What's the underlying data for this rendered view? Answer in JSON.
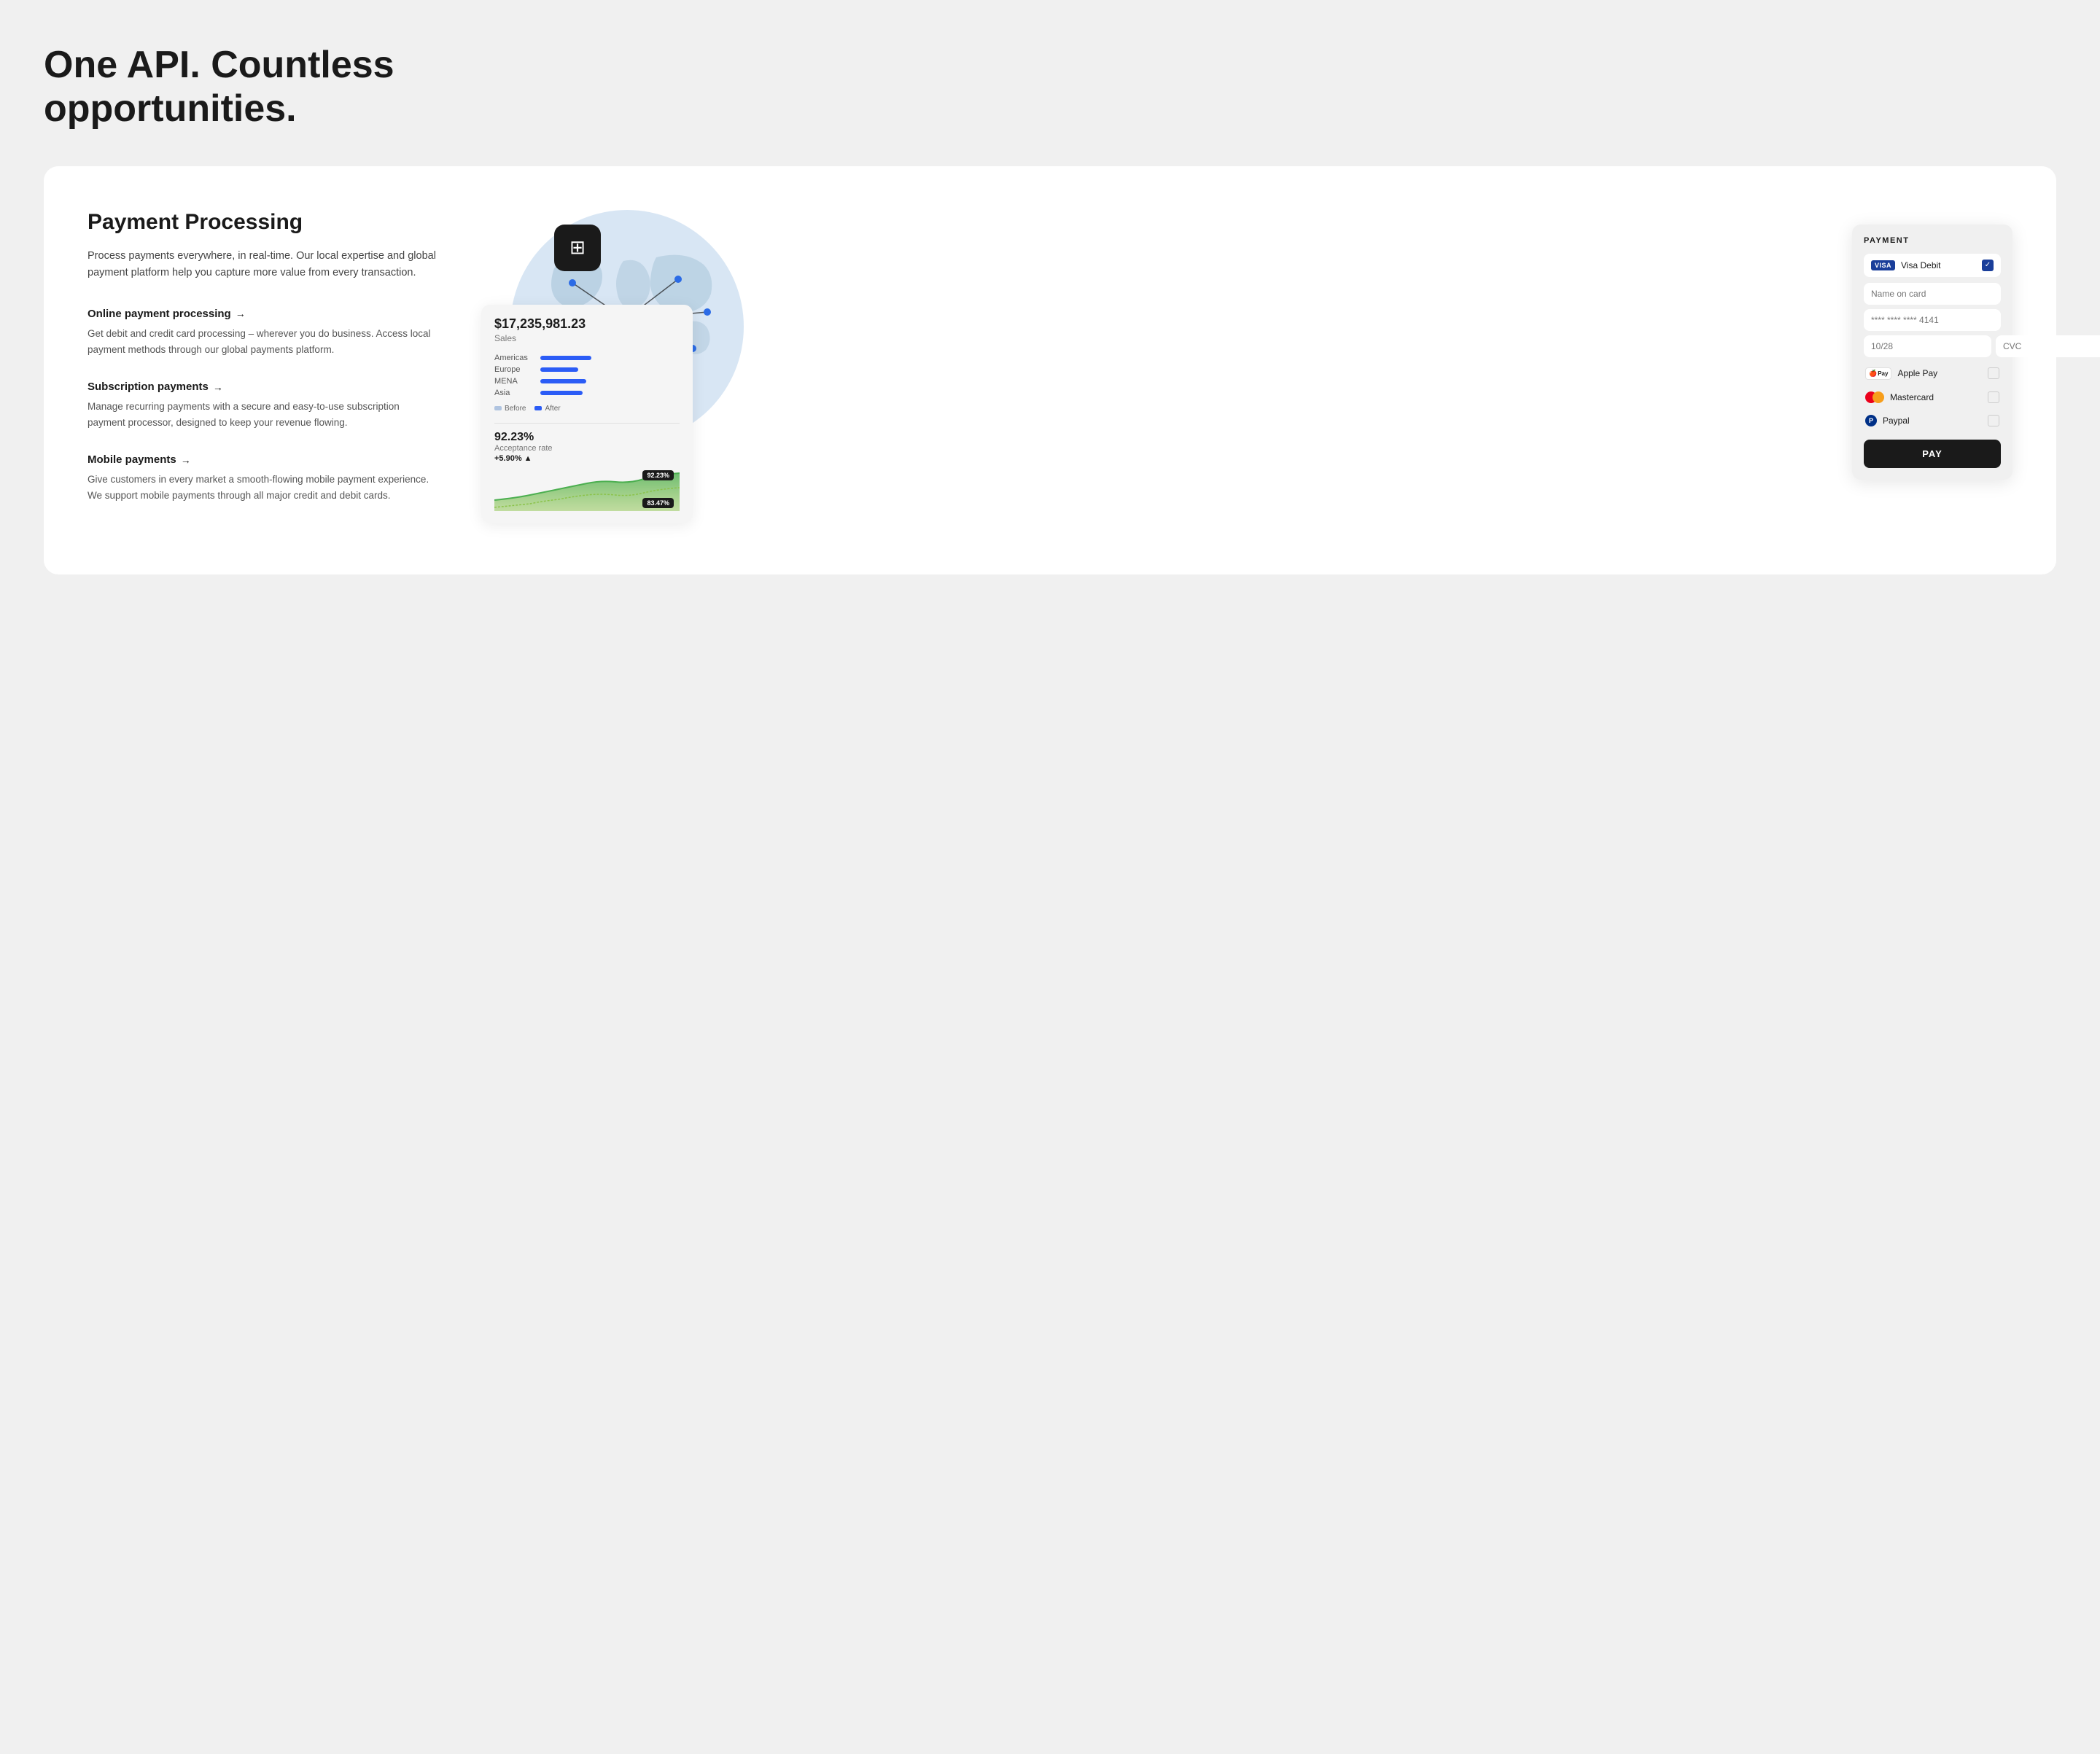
{
  "page": {
    "title_line1": "One API. Countless",
    "title_line2": "opportunities."
  },
  "card": {
    "section_title": "Payment Processing",
    "section_desc": "Process payments everywhere, in real-time. Our local expertise and global payment platform help you capture more value from every transaction.",
    "features": [
      {
        "title": "Online payment processing",
        "arrow": "→",
        "desc": "Get debit and credit card processing – wherever you do business. Access local payment methods through our global payments platform."
      },
      {
        "title": "Subscription payments",
        "arrow": "→",
        "desc": "Manage recurring payments with a secure and easy-to-use subscription payment processor, designed to keep your revenue flowing."
      },
      {
        "title": "Mobile payments",
        "arrow": "→",
        "desc": "Give customers in every market a smooth-flowing mobile payment experience. We support mobile payments through all major credit and debit cards."
      }
    ]
  },
  "dashboard": {
    "sales_amount": "$17,235,981.23",
    "sales_label": "Sales",
    "regions": [
      {
        "name": "Americas",
        "width": 70
      },
      {
        "name": "Europe",
        "width": 55
      },
      {
        "name": "MENA",
        "width": 65
      },
      {
        "name": "Asia",
        "width": 60
      }
    ],
    "legend_before": "Before",
    "legend_after": "After",
    "acceptance_rate": "92.23%",
    "acceptance_label": "Acceptance rate",
    "acceptance_change": "+5.90% ▲",
    "badge_high": "92.23%",
    "badge_low": "83.47%"
  },
  "payment": {
    "title": "PAYMENT",
    "visa_label": "Visa Debit",
    "name_placeholder": "Name on card",
    "card_placeholder": "**** **** **** 4141",
    "expiry_placeholder": "10/28",
    "cvc_placeholder": "CVC",
    "methods": [
      {
        "id": "apple_pay",
        "label": "Apple Pay",
        "icon": "apple"
      },
      {
        "id": "mastercard",
        "label": "Mastercard",
        "icon": "mastercard"
      },
      {
        "id": "paypal",
        "label": "Paypal",
        "icon": "paypal"
      }
    ],
    "pay_button": "PAY"
  }
}
